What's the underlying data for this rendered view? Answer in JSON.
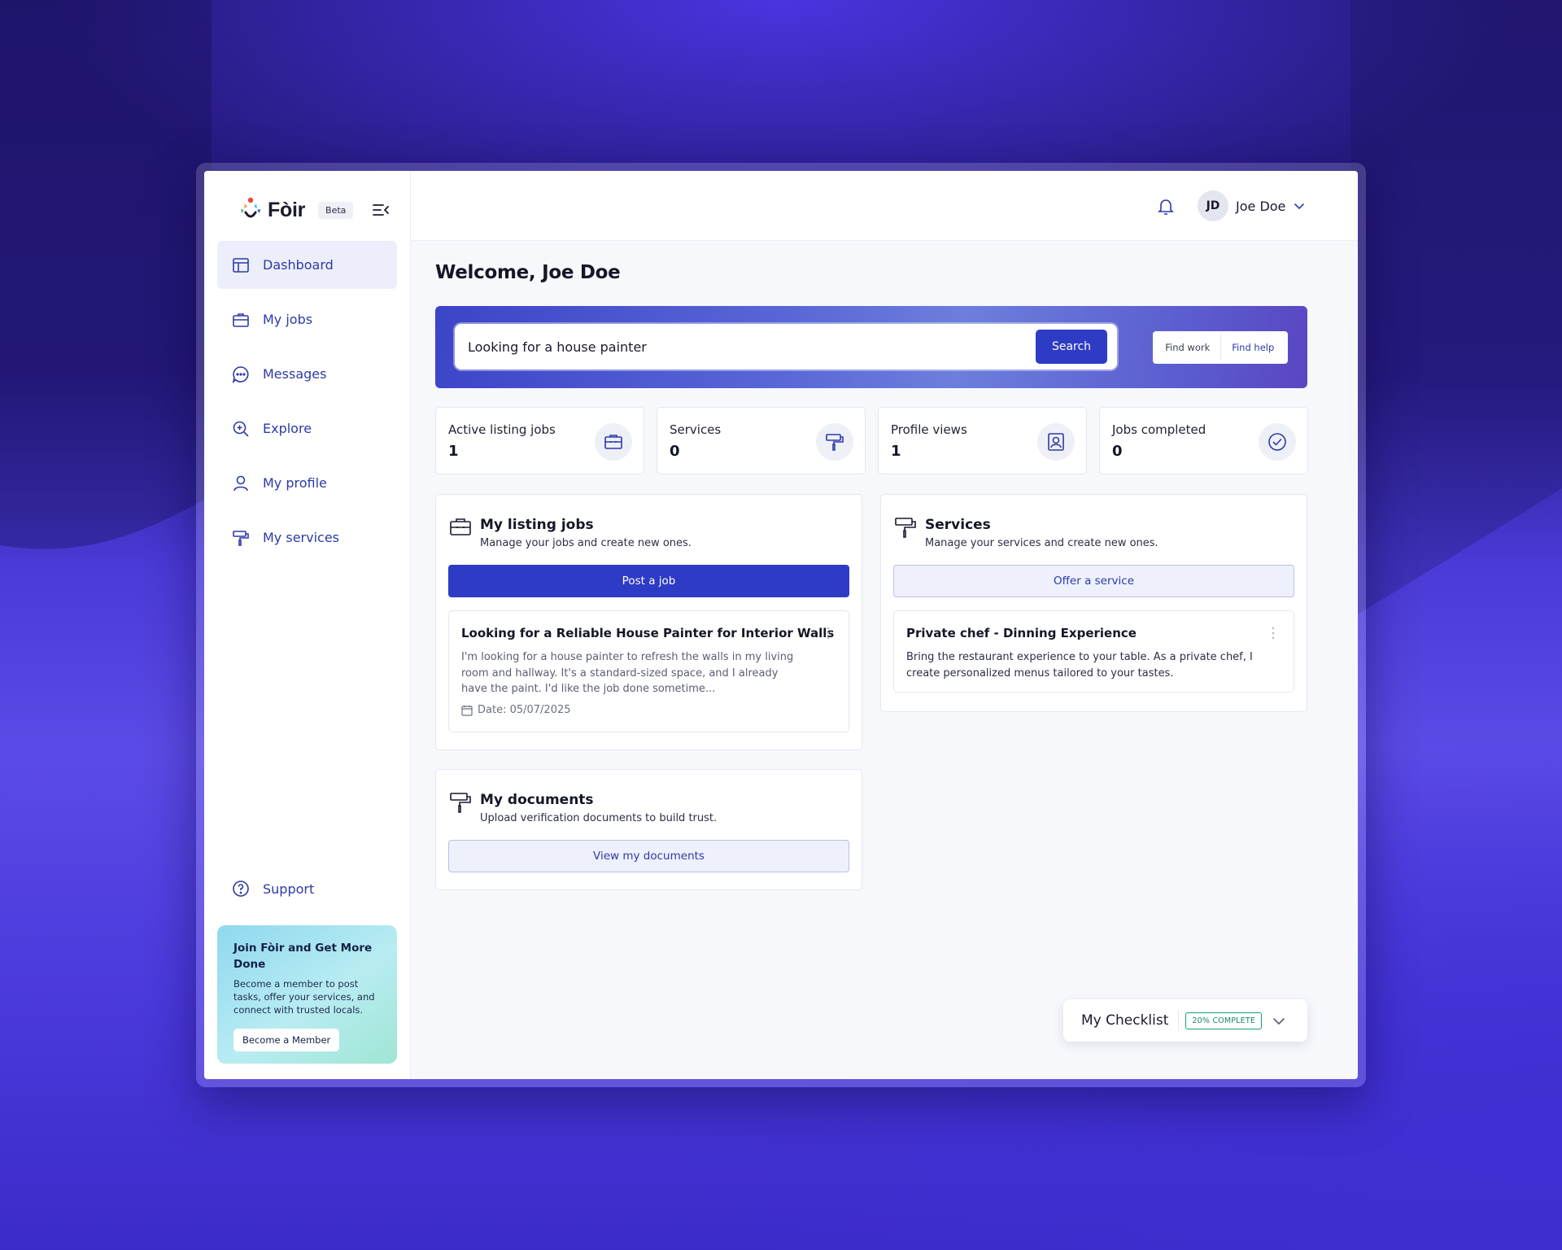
{
  "brand": {
    "name": "Fòir",
    "badge": "Beta"
  },
  "sidebar": {
    "items": [
      {
        "label": "Dashboard",
        "icon": "layout-icon",
        "active": true
      },
      {
        "label": "My jobs",
        "icon": "briefcase-icon",
        "active": false
      },
      {
        "label": "Messages",
        "icon": "chat-icon",
        "active": false
      },
      {
        "label": "Explore",
        "icon": "search-plus-icon",
        "active": false
      },
      {
        "label": "My profile",
        "icon": "user-icon",
        "active": false
      },
      {
        "label": "My services",
        "icon": "paint-roller-icon",
        "active": false
      }
    ],
    "support_label": "Support",
    "promo": {
      "title": "Join Fòir and Get More Done",
      "text": "Become a member to post tasks, offer your services, and connect with trusted locals.",
      "button": "Become a Member"
    }
  },
  "header": {
    "user_initials": "JD",
    "user_name": "Joe Doe"
  },
  "main": {
    "welcome": "Welcome, Joe Doe",
    "search": {
      "value": "Looking for a house painter",
      "button": "Search",
      "toggle": [
        "Find work",
        "Find help"
      ]
    },
    "stats": [
      {
        "label": "Active listing jobs",
        "value": "1",
        "icon": "briefcase-icon"
      },
      {
        "label": "Services",
        "value": "0",
        "icon": "paint-roller-icon"
      },
      {
        "label": "Profile views",
        "value": "1",
        "icon": "profile-card-icon"
      },
      {
        "label": "Jobs completed",
        "value": "0",
        "icon": "check-circle-icon"
      }
    ],
    "listing_jobs": {
      "title": "My listing jobs",
      "subtitle": "Manage your jobs and create new ones.",
      "button": "Post a job",
      "job": {
        "title": "Looking for a Reliable House Painter for Interior Walls",
        "description": "I'm looking for a house painter to refresh the walls in my living room and hallway. It's a standard-sized space, and I already have the paint. I'd like the job done sometime...",
        "date": "Date: 05/07/2025"
      }
    },
    "services": {
      "title": "Services",
      "subtitle": "Manage your services and create new ones.",
      "button": "Offer a service",
      "service": {
        "title": "Private chef - Dinning Experience",
        "description": "Bring the restaurant experience to your table. As a private chef, I create personalized menus tailored to your tastes."
      }
    },
    "documents": {
      "title": "My documents",
      "subtitle": "Upload verification documents to build trust.",
      "button": "View my documents"
    },
    "checklist": {
      "label": "My Checklist",
      "badge": "20% COMPLETE",
      "progress": 0.2
    }
  },
  "colors": {
    "accent": "#2e3bc4",
    "nav_text": "#2c3aa8",
    "success": "#178a60"
  }
}
